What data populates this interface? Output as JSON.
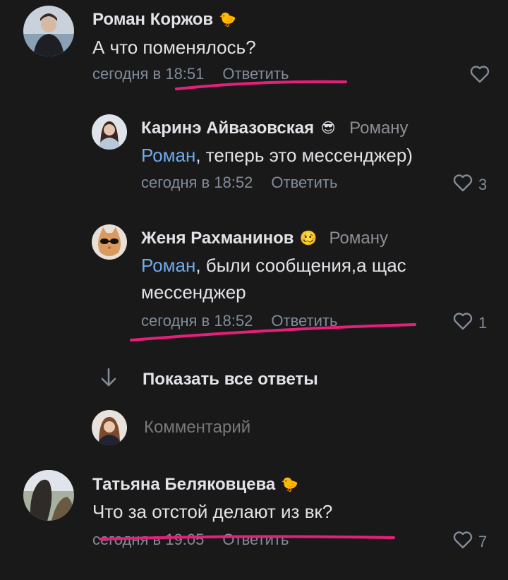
{
  "comments": [
    {
      "author": "Роман Коржов",
      "emoji": "🐤",
      "text": "А что поменялось?",
      "time": "сегодня в 18:51",
      "reply_label": "Ответить",
      "likes": ""
    }
  ],
  "replies": [
    {
      "author": "Каринэ Айвазовская",
      "emoji": "😎",
      "reply_to": "Роману",
      "mention": "Роман",
      "text_after": ", теперь это мессенджер)",
      "time": "сегодня в 18:52",
      "reply_label": "Ответить",
      "likes": "3"
    },
    {
      "author": "Женя Рахманинов",
      "emoji": "🥴",
      "reply_to": "Роману",
      "mention": "Роман",
      "text_after": ", были сообщения,а щас",
      "text_line2": "мессенджер",
      "time": "сегодня в 18:52",
      "reply_label": "Ответить",
      "likes": "1"
    }
  ],
  "show_all_label": "Показать все ответы",
  "comment_placeholder": "Комментарий",
  "last_comment": {
    "author": "Татьяна Беляковцева",
    "emoji": "🐤",
    "text": "Что за отстой делают из вк?",
    "time": "сегодня в 19:05",
    "reply_label": "Ответить",
    "likes": "7"
  },
  "colors": {
    "background": "#19191a",
    "mention": "#71aaeb",
    "secondary": "#818c99",
    "annotation": "#e6207a"
  },
  "icons": {
    "like": "heart-icon",
    "expand": "arrow-down-icon"
  }
}
